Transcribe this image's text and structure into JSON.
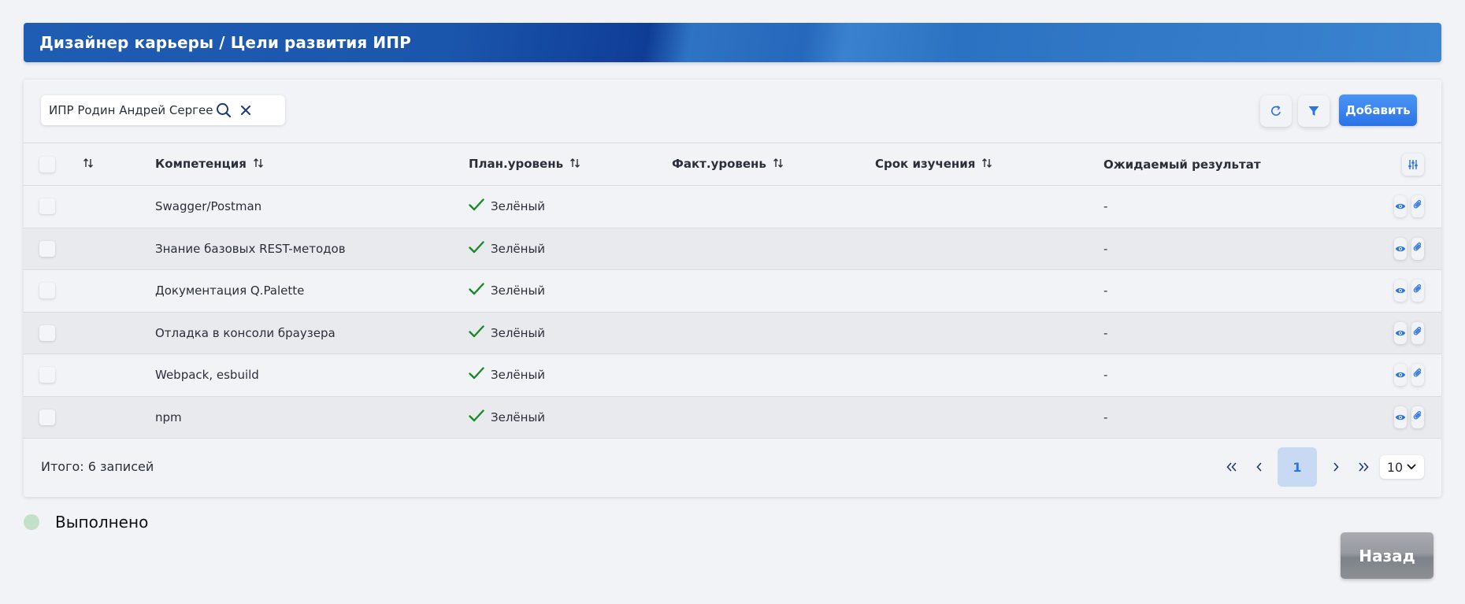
{
  "header": {
    "title": "Дизайнер карьеры / Цели развития ИПР"
  },
  "search": {
    "value": "ИПР Родин Андрей Сергее..."
  },
  "toolbar": {
    "add_label": "Добавить"
  },
  "table": {
    "columns": [
      "Компетенция",
      "План.уровень",
      "Факт.уровень",
      "Срок изучения",
      "Ожидаемый результат"
    ],
    "rows": [
      {
        "competence": "Swagger/Postman",
        "plan_level": "Зелёный",
        "fact_level": "",
        "term": "",
        "result": "-"
      },
      {
        "competence": "Знание базовых REST-методов",
        "plan_level": "Зелёный",
        "fact_level": "",
        "term": "",
        "result": "-"
      },
      {
        "competence": "Документация Q.Palette",
        "plan_level": "Зелёный",
        "fact_level": "",
        "term": "",
        "result": "-"
      },
      {
        "competence": "Отладка в консоли браузера",
        "plan_level": "Зелёный",
        "fact_level": "",
        "term": "",
        "result": "-"
      },
      {
        "competence": "Webpack, esbuild",
        "plan_level": "Зелёный",
        "fact_level": "",
        "term": "",
        "result": "-"
      },
      {
        "competence": "npm",
        "plan_level": "Зелёный",
        "fact_level": "",
        "term": "",
        "result": "-"
      }
    ]
  },
  "footer": {
    "total": "Итого: 6 записей",
    "current_page": "1",
    "page_size": "10"
  },
  "legend": {
    "label": "Выполнено",
    "color": "#c3e0c8"
  },
  "back_label": "Назад",
  "colors": {
    "accent": "#2b73e6",
    "check": "#1a8a2a",
    "header": "#1f5cb3"
  }
}
